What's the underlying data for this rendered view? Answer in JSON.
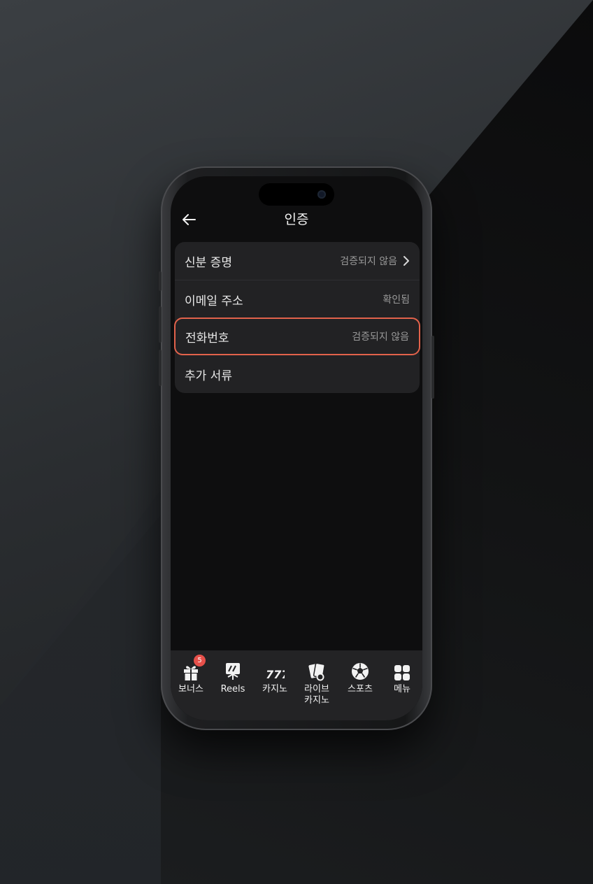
{
  "header": {
    "title": "인증"
  },
  "verification": {
    "items": [
      {
        "label": "신분 증명",
        "status": "검증되지 않음"
      },
      {
        "label": "이메일 주소",
        "status": "확인됨"
      },
      {
        "label": "전화번호",
        "status": "검증되지 않음"
      },
      {
        "label": "추가 서류",
        "status": ""
      }
    ]
  },
  "tabbar": {
    "items": [
      {
        "label": "보너스",
        "icon": "gift-icon",
        "badge": "5"
      },
      {
        "label": "Reels",
        "icon": "reels-icon"
      },
      {
        "label": "카지노",
        "icon": "slot-777-icon"
      },
      {
        "label": "라이브\n카지노",
        "icon": "live-casino-cards-icon"
      },
      {
        "label": "스포츠",
        "icon": "soccer-ball-icon"
      },
      {
        "label": "메뉴",
        "icon": "grid-menu-icon"
      }
    ]
  },
  "colors": {
    "highlight": "#e2624b",
    "badge": "#e6504a"
  }
}
